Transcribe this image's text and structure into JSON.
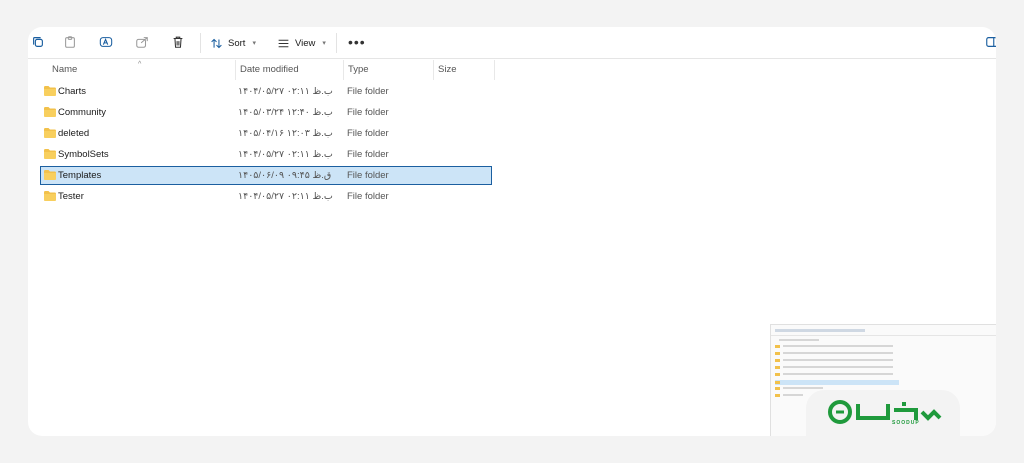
{
  "toolbar": {
    "sort_label": "Sort",
    "view_label": "View",
    "more_label": "•••"
  },
  "columns": {
    "name": "Name",
    "date_modified": "Date modified",
    "type": "Type",
    "size": "Size"
  },
  "files": [
    {
      "name": "Charts",
      "date": "۱۴۰۴/۰۵/۲۷ ب.ظ ۰۲:۱۱",
      "type": "File folder"
    },
    {
      "name": "Community",
      "date": "۱۴۰۵/۰۳/۲۴ ب.ظ ۱۲:۴۰",
      "type": "File folder"
    },
    {
      "name": "deleted",
      "date": "۱۴۰۵/۰۴/۱۶ ب.ظ ۱۲:۰۳",
      "type": "File folder"
    },
    {
      "name": "SymbolSets",
      "date": "۱۴۰۴/۰۵/۲۷ ب.ظ ۰۲:۱۱",
      "type": "File folder"
    },
    {
      "name": "Templates",
      "date": "۱۴۰۵/۰۶/۰۹ ق.ظ ۰۹:۴۵",
      "type": "File folder",
      "selected": true
    },
    {
      "name": "Tester",
      "date": "۱۴۰۴/۰۵/۲۷ ب.ظ ۰۲:۱۱",
      "type": "File folder"
    }
  ],
  "logo": {
    "wordmark": "SOODUP"
  },
  "colors": {
    "accent": "#1b5fa0",
    "selection": "#cce4f7",
    "folder": "#f2c14b",
    "logo_green": "#1f9a3c"
  }
}
